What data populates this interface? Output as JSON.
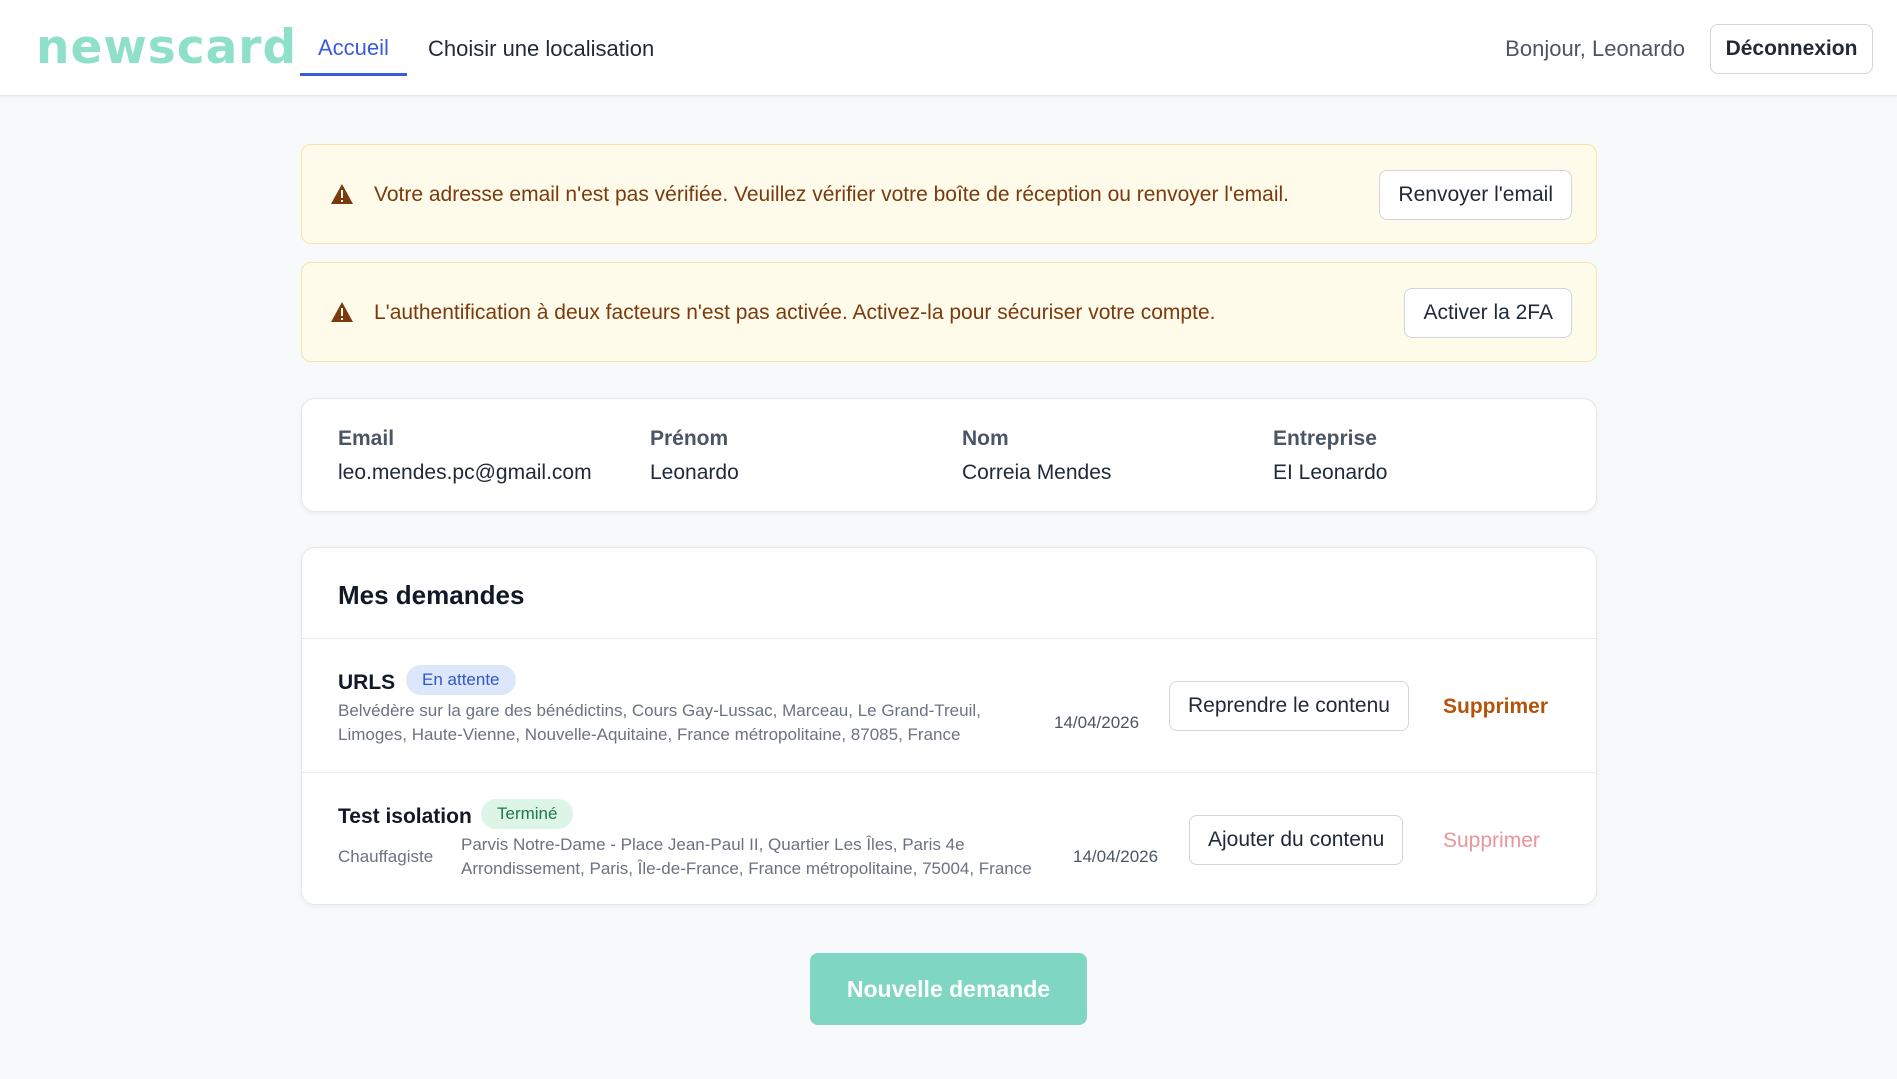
{
  "header": {
    "logo": "newscard",
    "nav": [
      {
        "label": "Accueil",
        "active": true
      },
      {
        "label": "Choisir une localisation",
        "active": false
      }
    ],
    "greeting": "Bonjour, Leonardo",
    "logout_label": "Déconnexion"
  },
  "alerts": [
    {
      "message": "Votre adresse email n'est pas vérifiée. Veuillez vérifier votre boîte de réception ou renvoyer l'email.",
      "button": "Renvoyer l'email",
      "icon": "warning-icon"
    },
    {
      "message": "L'authentification à deux facteurs n'est pas activée. Activez-la pour sécuriser votre compte.",
      "button": "Activer la 2FA",
      "icon": "warning-icon"
    }
  ],
  "profile": {
    "fields": [
      {
        "label": "Email",
        "value": "leo.mendes.pc@gmail.com"
      },
      {
        "label": "Prénom",
        "value": "Leonardo"
      },
      {
        "label": "Nom",
        "value": "Correia Mendes"
      },
      {
        "label": "Entreprise",
        "value": "EI Leonardo"
      }
    ]
  },
  "requests": {
    "title": "Mes demandes",
    "items": [
      {
        "title": "URLS",
        "status": "En attente",
        "category": "",
        "address_line1": "Belvédère sur la gare des bénédictins, Cours Gay-Lussac, Marceau, Le Grand-Treuil,",
        "address_line2": "Limoges, Haute-Vienne, Nouvelle-Aquitaine, France métropolitaine, 87085, France",
        "date": "14/04/2026",
        "action": "Reprendre le contenu",
        "delete": "Supprimer"
      },
      {
        "title": "Test isolation",
        "status": "Terminé",
        "category": "Chauffagiste",
        "address_line1": "Parvis Notre-Dame - Place Jean-Paul II, Quartier Les Îles, Paris 4e",
        "address_line2": "Arrondissement, Paris, Île-de-France, France métropolitaine, 75004, France",
        "date": "14/04/2026",
        "action": "Ajouter du contenu",
        "delete": "Supprimer"
      }
    ]
  },
  "new_request_label": "Nouvelle demande",
  "colors": {
    "brand": "#8ee0c8",
    "accent": "#3b5bdb",
    "alert_bg": "#fffbea",
    "alert_text": "#7a3a0e",
    "delete_active": "#b45309",
    "delete_disabled": "#e8959b",
    "primary_button": "#7fd6c2"
  }
}
